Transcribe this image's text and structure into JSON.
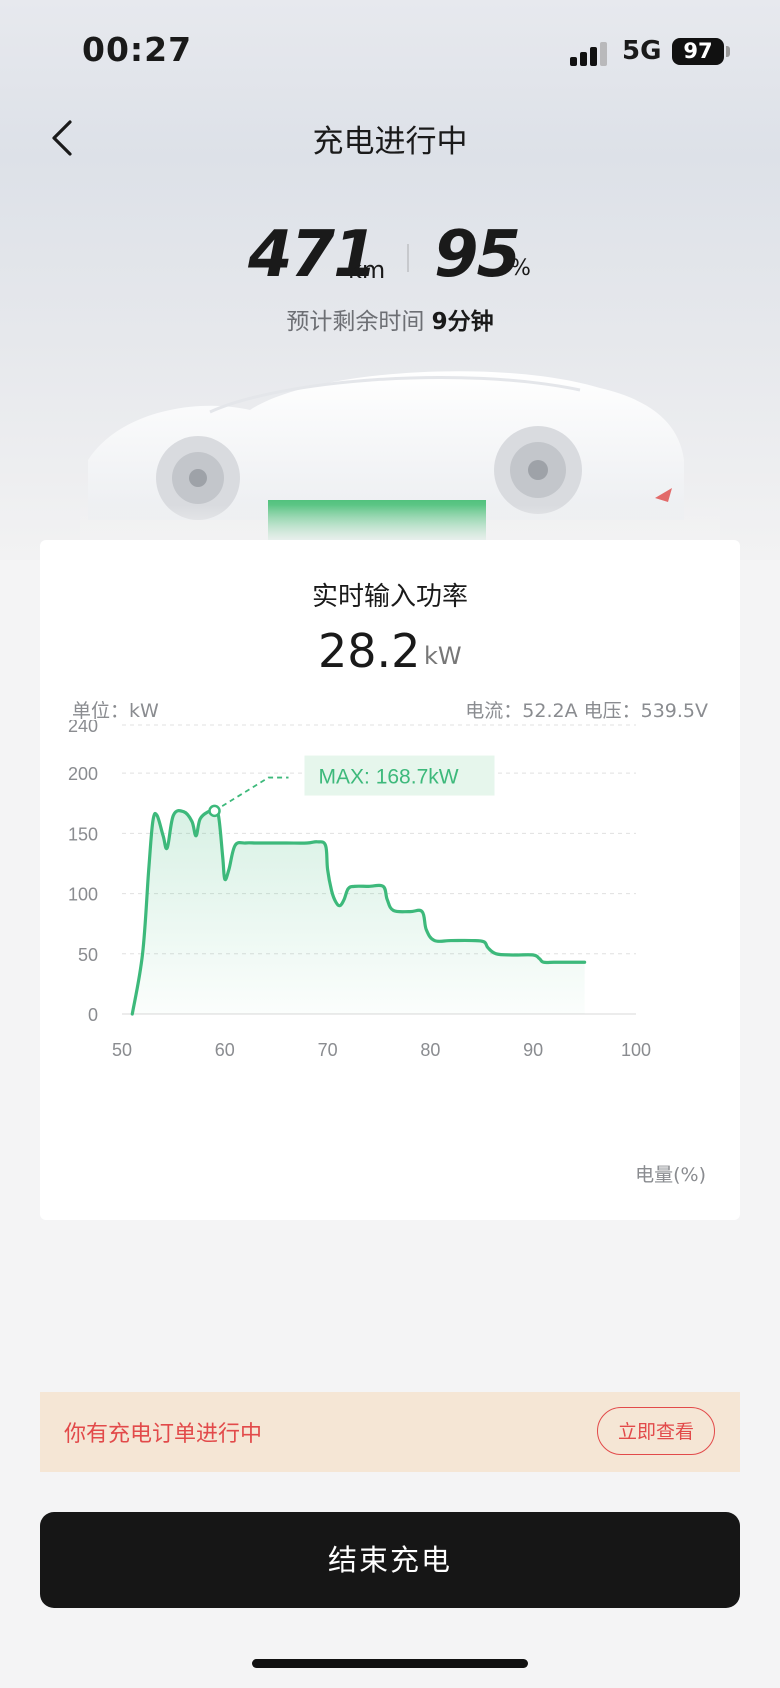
{
  "status_bar": {
    "time": "00:27",
    "network": "5G",
    "battery": "97"
  },
  "header": {
    "title": "充电进行中"
  },
  "stats": {
    "range_value": "471",
    "range_unit": "km",
    "soc_value": "95",
    "soc_unit": "%",
    "remaining_label": "预计剩余时间",
    "remaining_value": "9分钟"
  },
  "power_card": {
    "title": "实时输入功率",
    "value": "28.2",
    "unit": "kW",
    "unit_label": "单位：kW",
    "current_voltage": "电流：52.2A   电压：539.5V"
  },
  "chart_data": {
    "type": "area",
    "xlabel": "电量(%)",
    "ylabel": "单位：kW",
    "xlim": [
      50,
      100
    ],
    "ylim": [
      0,
      240
    ],
    "x_ticks": [
      50,
      60,
      70,
      80,
      90,
      100
    ],
    "y_ticks": [
      0,
      50,
      100,
      150,
      200,
      240
    ],
    "grid": true,
    "color": "#3db97b",
    "annotation": {
      "text": "MAX: 168.7kW",
      "x": 59,
      "y": 168.7
    },
    "x": [
      51,
      52,
      52.6,
      53,
      53.4,
      54,
      54.4,
      55,
      56,
      56.8,
      57.2,
      57.6,
      58.4,
      59,
      59.4,
      59.8,
      60,
      60.4,
      61,
      62,
      63,
      64,
      66,
      68,
      69,
      69.8,
      70,
      70.4,
      70.8,
      71.2,
      71.6,
      72,
      72.6,
      74,
      75.4,
      75.8,
      76.4,
      78,
      79.2,
      79.6,
      80.4,
      82,
      84,
      85.2,
      85.6,
      86.4,
      88,
      90,
      90.6,
      91,
      92,
      93,
      95
    ],
    "values": [
      0,
      50,
      120,
      160,
      165,
      148,
      138,
      165,
      168,
      160,
      148,
      162,
      168,
      168.7,
      164,
      130,
      112,
      120,
      140,
      142,
      142,
      142,
      142,
      142,
      143,
      140,
      120,
      102,
      93,
      90,
      95,
      104,
      106,
      106,
      106,
      95,
      86,
      85,
      85,
      70,
      61,
      61,
      61,
      60,
      55,
      50,
      49,
      49,
      46,
      43,
      43,
      43,
      43
    ]
  },
  "notice": {
    "text": "你有充电订单进行中",
    "button": "立即查看"
  },
  "actions": {
    "end_charge": "结束充电"
  }
}
